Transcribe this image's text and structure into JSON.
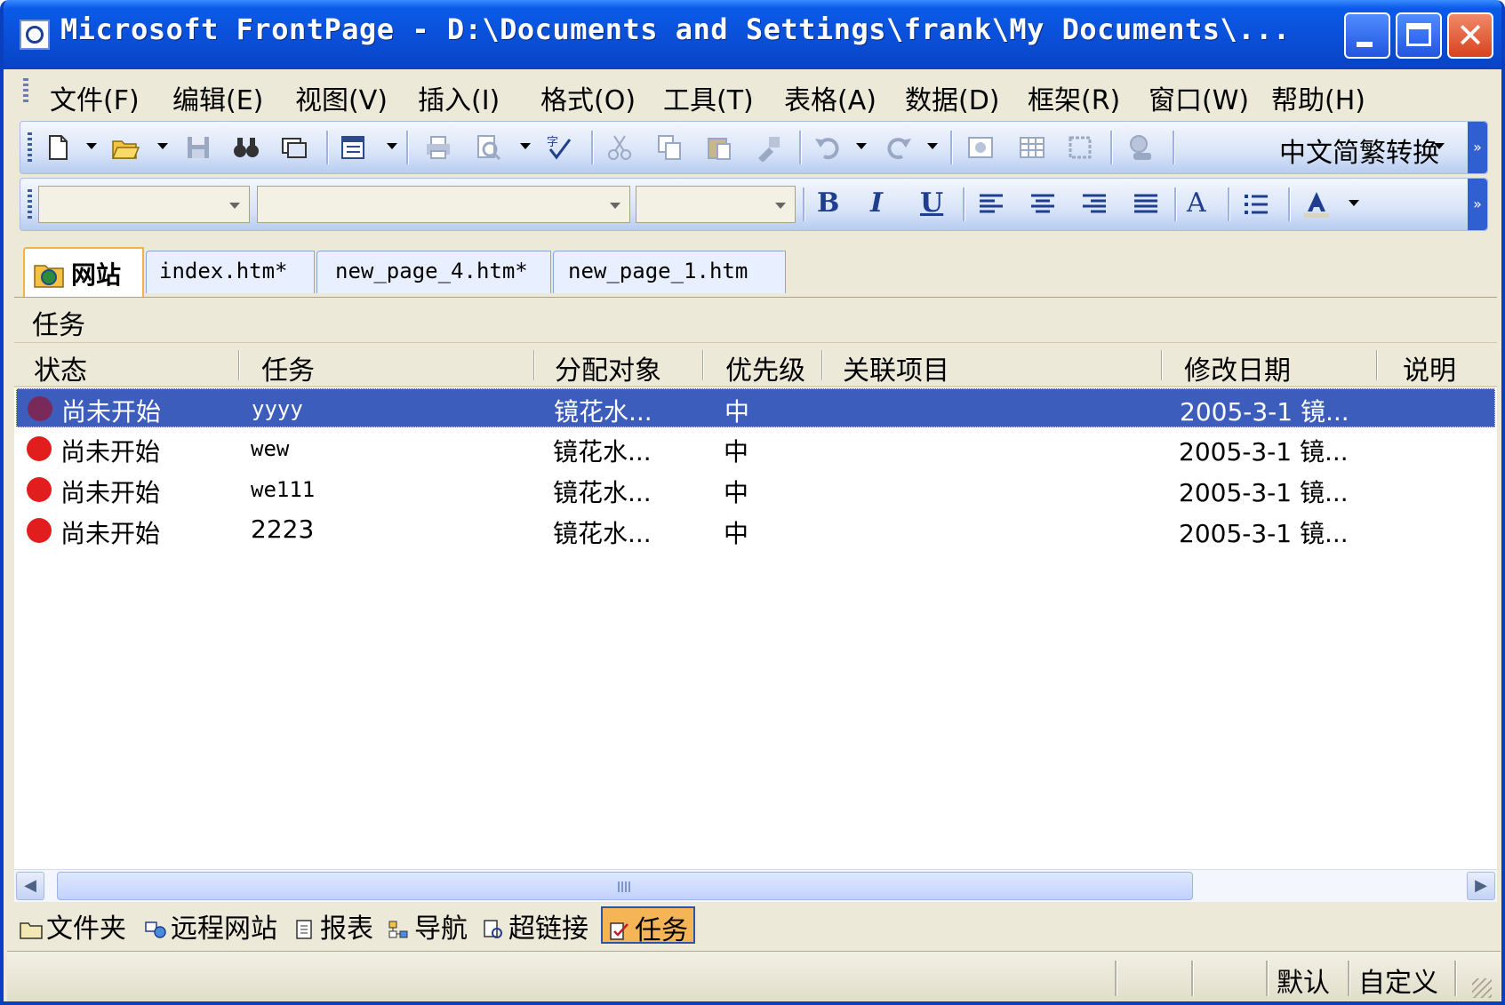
{
  "window": {
    "title": "Microsoft FrontPage - D:\\Documents and Settings\\frank\\My Documents\\...",
    "close_glyph": "✕"
  },
  "menu": [
    "文件(F)",
    "编辑(E)",
    "视图(V)",
    "插入(I)",
    "格式(O)",
    "工具(T)",
    "表格(A)",
    "数据(D)",
    "框架(R)",
    "窗口(W)",
    "帮助(H)"
  ],
  "toolbar": {
    "convert_label": "中文简繁转换",
    "style_value": "",
    "font_value": "",
    "size_value": "",
    "bold": "B",
    "italic": "I",
    "underline": "U",
    "grow_font": "A"
  },
  "tabs": [
    {
      "label": "网站",
      "active": true
    },
    {
      "label": "index.htm*",
      "active": false
    },
    {
      "label": "new_page_4.htm*",
      "active": false
    },
    {
      "label": "new_page_1.htm",
      "active": false
    }
  ],
  "pane": {
    "title": "任务"
  },
  "columns": [
    "状态",
    "任务",
    "分配对象",
    "优先级",
    "关联项目",
    "修改日期",
    "说明"
  ],
  "rows": [
    {
      "status": "尚未开始",
      "task": "yyyy",
      "assigned": "镜花水...",
      "priority": "中",
      "linked": "",
      "modified": "2005-3-1 镜...",
      "note": "",
      "selected": true
    },
    {
      "status": "尚未开始",
      "task": "wew",
      "assigned": "镜花水...",
      "priority": "中",
      "linked": "",
      "modified": "2005-3-1 镜...",
      "note": "",
      "selected": false
    },
    {
      "status": "尚未开始",
      "task": "we111",
      "assigned": "镜花水...",
      "priority": "中",
      "linked": "",
      "modified": "2005-3-1 镜...",
      "note": "",
      "selected": false
    },
    {
      "status": "尚未开始",
      "task": "2223",
      "assigned": "镜花水...",
      "priority": "中",
      "linked": "",
      "modified": "2005-3-1 镜...",
      "note": "",
      "selected": false
    }
  ],
  "views": [
    {
      "label": "文件夹",
      "icon": "folder-icon"
    },
    {
      "label": "远程网站",
      "icon": "remote-site-icon"
    },
    {
      "label": "报表",
      "icon": "report-icon"
    },
    {
      "label": "导航",
      "icon": "navigation-icon"
    },
    {
      "label": "超链接",
      "icon": "hyperlink-icon"
    },
    {
      "label": "任务",
      "icon": "tasks-icon",
      "active": true
    }
  ],
  "status": {
    "default_label": "默认",
    "custom_label": "自定义"
  },
  "colors": {
    "title_bar": "#0a4fd8",
    "selection": "#3c5dbb",
    "status_dot": "#e21d1d",
    "active_view": "#f5b556"
  }
}
